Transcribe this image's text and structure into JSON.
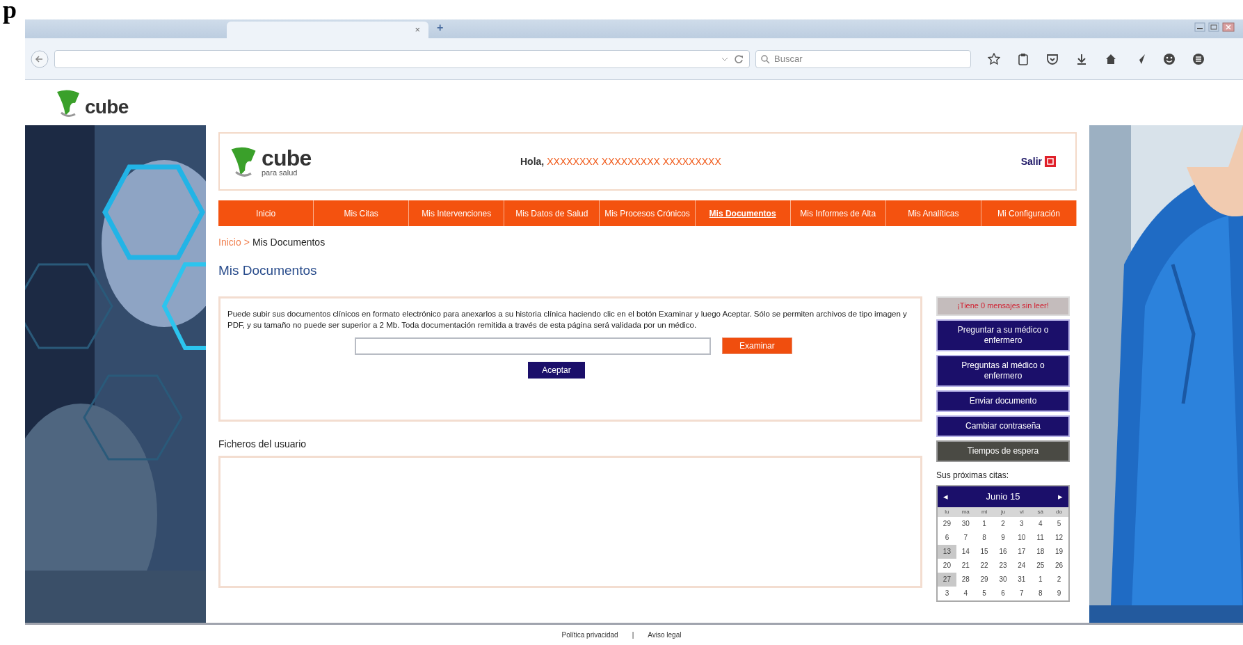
{
  "heading_fragment": "p",
  "browser": {
    "tab_close": "×",
    "new_tab": "+",
    "search_placeholder": "Buscar"
  },
  "site_logo": {
    "word": "cube"
  },
  "header": {
    "logo_word": "cube",
    "logo_tagline": "para salud",
    "greeting": "Hola,",
    "user_name": "XXXXXXXX XXXXXXXXX XXXXXXXXX",
    "logout": "Salir"
  },
  "nav": [
    {
      "label": "Inicio",
      "selected": false
    },
    {
      "label": "Mis Citas",
      "selected": false
    },
    {
      "label": "Mis Intervenciones",
      "selected": false
    },
    {
      "label": "Mis Datos de Salud",
      "selected": false
    },
    {
      "label": "Mis Procesos Crónicos",
      "selected": false
    },
    {
      "label": "Mis Documentos",
      "selected": true
    },
    {
      "label": "Mis Informes de Alta",
      "selected": false
    },
    {
      "label": "Mis Analíticas",
      "selected": false
    },
    {
      "label": "Mi Configuración",
      "selected": false
    }
  ],
  "breadcrumb": {
    "link": "Inicio",
    "separator": ">",
    "current": "Mis Documentos"
  },
  "title": "Mis Documentos",
  "upload": {
    "instructions": "Puede subir sus documentos clínicos en formato electrónico para anexarlos a su historia clínica haciendo clic en el botón Examinar y luego Aceptar. Sólo se permiten archivos de tipo imagen y PDF, y su tamaño no puede ser superior a 2 Mb. Toda documentación remitida a través de esta página será validada por un médico.",
    "browse": "Examinar",
    "accept": "Aceptar"
  },
  "files": {
    "heading": "Ficheros del usuario"
  },
  "sidebar": {
    "messages": "¡Tiene 0 mensajes sin leer!",
    "buttons": [
      {
        "label": "Preguntar a su médico o enfermero",
        "kind": "primary"
      },
      {
        "label": "Preguntas al médico o enfermero",
        "kind": "primary"
      },
      {
        "label": "Enviar documento",
        "kind": "primary"
      },
      {
        "label": "Cambiar contraseña",
        "kind": "primary"
      },
      {
        "label": "Tiempos de espera",
        "kind": "secondary"
      }
    ],
    "appointments_label": "Sus próximas citas:"
  },
  "calendar": {
    "prev": "◂",
    "month": "Junio 15",
    "next": "▸",
    "weekdays": [
      "lu",
      "ma",
      "mi",
      "ju",
      "vi",
      "sá",
      "do"
    ],
    "weeks": [
      [
        {
          "d": "29",
          "highlighted": false
        },
        {
          "d": "30",
          "highlighted": false
        },
        {
          "d": "1",
          "highlighted": false
        },
        {
          "d": "2",
          "highlighted": false
        },
        {
          "d": "3",
          "highlighted": false
        },
        {
          "d": "4",
          "highlighted": false
        },
        {
          "d": "5",
          "highlighted": false
        }
      ],
      [
        {
          "d": "6",
          "highlighted": false
        },
        {
          "d": "7",
          "highlighted": false
        },
        {
          "d": "8",
          "highlighted": false
        },
        {
          "d": "9",
          "highlighted": false
        },
        {
          "d": "10",
          "highlighted": false
        },
        {
          "d": "11",
          "highlighted": false
        },
        {
          "d": "12",
          "highlighted": false
        }
      ],
      [
        {
          "d": "13",
          "highlighted": true
        },
        {
          "d": "14",
          "highlighted": false
        },
        {
          "d": "15",
          "highlighted": false
        },
        {
          "d": "16",
          "highlighted": false
        },
        {
          "d": "17",
          "highlighted": false
        },
        {
          "d": "18",
          "highlighted": false
        },
        {
          "d": "19",
          "highlighted": false
        }
      ],
      [
        {
          "d": "20",
          "highlighted": false
        },
        {
          "d": "21",
          "highlighted": false
        },
        {
          "d": "22",
          "highlighted": false
        },
        {
          "d": "23",
          "highlighted": false
        },
        {
          "d": "24",
          "highlighted": false
        },
        {
          "d": "25",
          "highlighted": false
        },
        {
          "d": "26",
          "highlighted": false
        }
      ],
      [
        {
          "d": "27",
          "highlighted": true
        },
        {
          "d": "28",
          "highlighted": false
        },
        {
          "d": "29",
          "highlighted": false
        },
        {
          "d": "30",
          "highlighted": false
        },
        {
          "d": "31",
          "highlighted": false
        },
        {
          "d": "1",
          "highlighted": false
        },
        {
          "d": "2",
          "highlighted": false
        }
      ],
      [
        {
          "d": "3",
          "highlighted": false
        },
        {
          "d": "4",
          "highlighted": false
        },
        {
          "d": "5",
          "highlighted": false
        },
        {
          "d": "6",
          "highlighted": false
        },
        {
          "d": "7",
          "highlighted": false
        },
        {
          "d": "8",
          "highlighted": false
        },
        {
          "d": "9",
          "highlighted": false
        }
      ]
    ]
  },
  "footer": {
    "links": [
      "Política privacidad",
      "Aviso legal"
    ],
    "separator": "|"
  }
}
